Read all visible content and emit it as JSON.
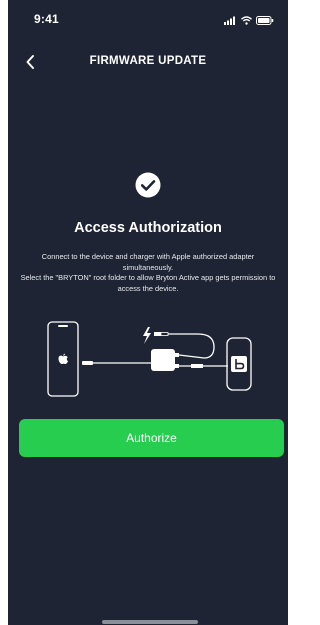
{
  "status_bar": {
    "time": "9:41",
    "icons": [
      "signal-icon",
      "wifi-icon",
      "battery-icon"
    ]
  },
  "header": {
    "title": "FIRMWARE UPDATE",
    "back_icon": "chevron-left-icon"
  },
  "main": {
    "status_icon": "checkmark-circle-icon",
    "title": "Access Authorization",
    "description_line1": "Connect to the device and charger with Apple authorized adapter simultaneously.",
    "description_line2": "Select the \"BRYTON\" root folder to allow Bryton Active app gets permission to access the device.",
    "illustration_icons": [
      "iphone-icon",
      "apple-logo-icon",
      "adapter-icon",
      "lightning-bolt-icon",
      "usb-cable-icon",
      "bryton-device-icon"
    ]
  },
  "actions": {
    "authorize_label": "Authorize"
  },
  "colors": {
    "background": "#1e2433",
    "accent": "#27cd4f",
    "text": "#ffffff"
  }
}
